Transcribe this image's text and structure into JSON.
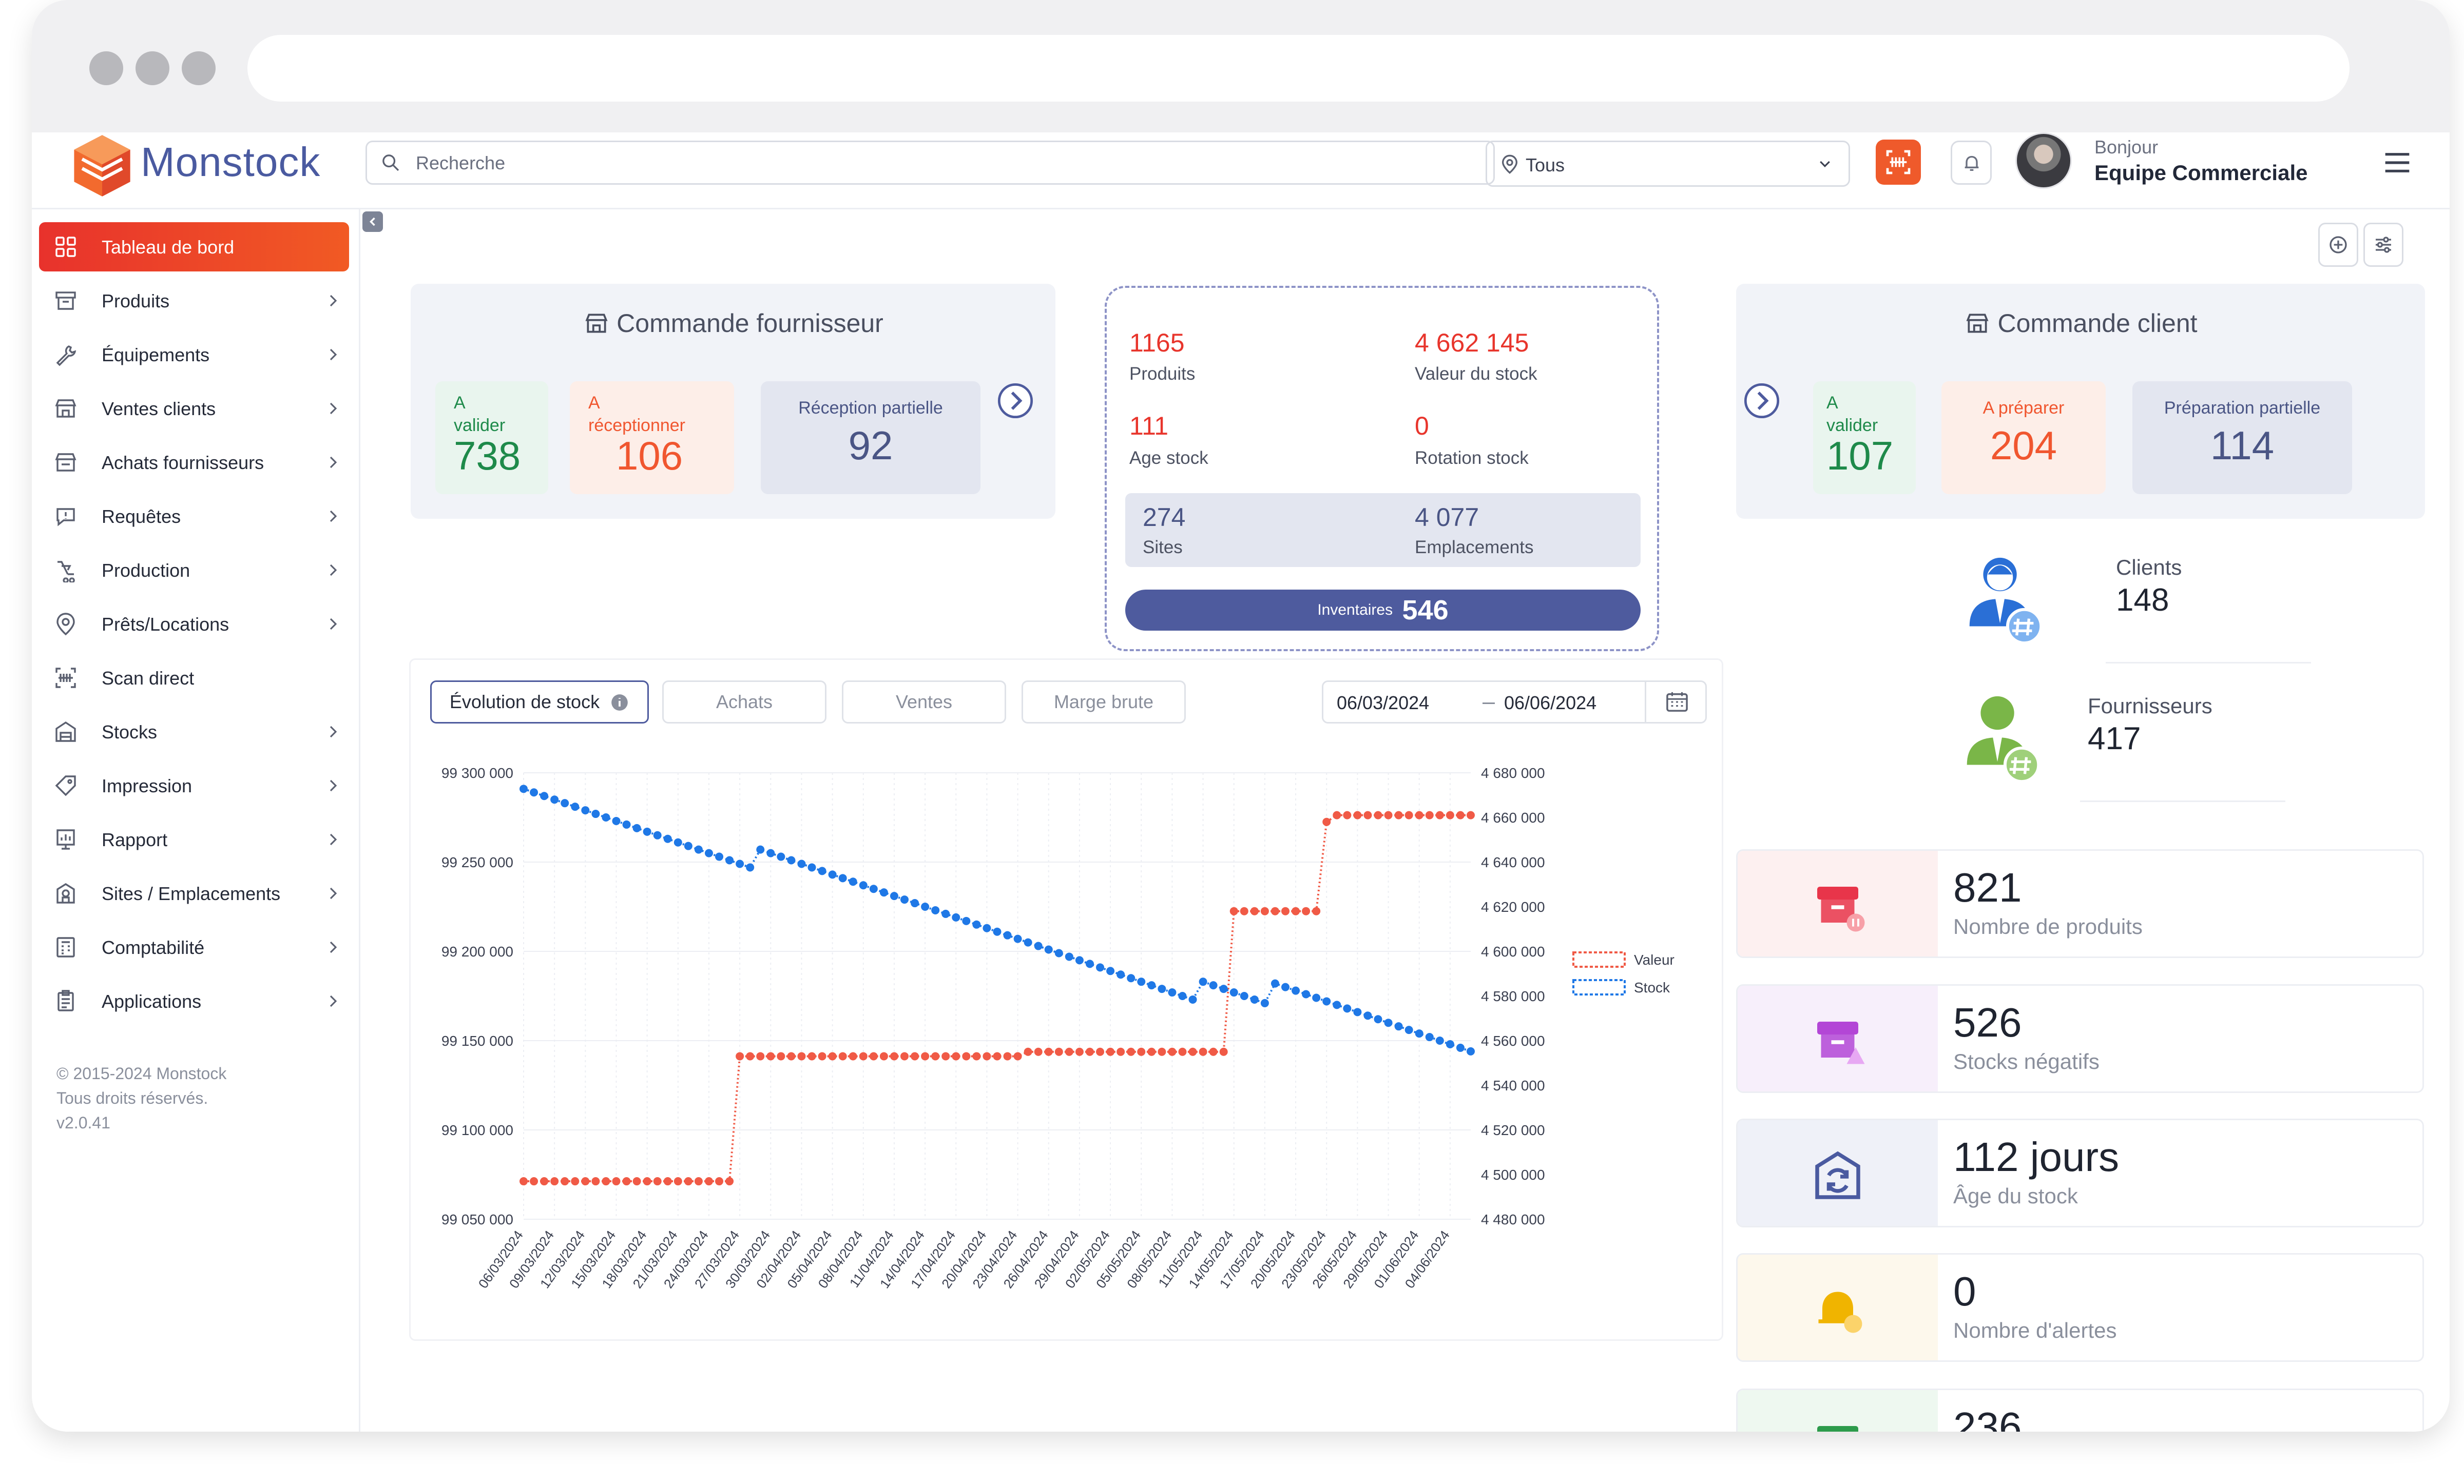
{
  "app": {
    "name": "Monstock"
  },
  "header": {
    "search_placeholder": "Recherche",
    "site_filter": "Tous",
    "greeting": "Bonjour",
    "user_name": "Equipe Commerciale"
  },
  "sidebar": {
    "items": [
      {
        "label": "Tableau de bord",
        "icon": "dashboard-icon",
        "active": true
      },
      {
        "label": "Produits",
        "icon": "box-icon"
      },
      {
        "label": "Équipements",
        "icon": "wrench-icon"
      },
      {
        "label": "Ventes clients",
        "icon": "store-icon"
      },
      {
        "label": "Achats fournisseurs",
        "icon": "cart-icon"
      },
      {
        "label": "Requêtes",
        "icon": "message-icon"
      },
      {
        "label": "Production",
        "icon": "factory-icon"
      },
      {
        "label": "Prêts/Locations",
        "icon": "location-pin-icon"
      },
      {
        "label": "Scan direct",
        "icon": "barcode-icon"
      },
      {
        "label": "Stocks",
        "icon": "warehouse-icon"
      },
      {
        "label": "Impression",
        "icon": "tag-icon"
      },
      {
        "label": "Rapport",
        "icon": "report-icon"
      },
      {
        "label": "Sites / Emplacements",
        "icon": "building-icon"
      },
      {
        "label": "Comptabilité",
        "icon": "calculator-icon"
      },
      {
        "label": "Applications",
        "icon": "clipboard-icon"
      }
    ],
    "footer": [
      "© 2015-2024 Monstock",
      "Tous droits réservés.",
      "v2.0.41"
    ]
  },
  "supplier_orders": {
    "title": "Commande fournisseur",
    "kpis": [
      {
        "label_1": "A",
        "label_2": "valider",
        "value": "738",
        "color": "#1e8a4a",
        "bg": "#e9f5ee"
      },
      {
        "label_1": "A",
        "label_2": "réceptionner",
        "value": "106",
        "color": "#f0562f",
        "bg": "#fdeee8"
      },
      {
        "label_1": "Réception partielle",
        "label_2": "",
        "value": "92",
        "color": "#4a5585",
        "bg": "#e3e6f0"
      }
    ]
  },
  "client_orders": {
    "title": "Commande client",
    "kpis": [
      {
        "label_1": "A",
        "label_2": "valider",
        "value": "107",
        "color": "#1e8a4a",
        "bg": "#e9f5ee"
      },
      {
        "label_1": "A préparer",
        "label_2": "",
        "value": "204",
        "color": "#f0562f",
        "bg": "#fdeee8"
      },
      {
        "label_1": "Préparation partielle",
        "label_2": "",
        "value": "114",
        "color": "#4a5585",
        "bg": "#e3e6f0"
      }
    ]
  },
  "inventory": {
    "products_value": "1165",
    "products_label": "Produits",
    "stock_value": "4 662 145",
    "stock_label": "Valeur du stock",
    "age_value": "111",
    "age_label": "Age stock",
    "rotation_value": "0",
    "rotation_label": "Rotation stock",
    "sites_value": "274",
    "sites_label": "Sites",
    "locations_value": "4 077",
    "locations_label": "Emplacements",
    "inventories_label": "Inventaires",
    "inventories_value": "546"
  },
  "contacts": {
    "clients_label": "Clients",
    "clients_value": "148",
    "suppliers_label": "Fournisseurs",
    "suppliers_value": "417"
  },
  "stats": [
    {
      "value": "821",
      "label": "Nombre de produits",
      "icon": "box-alert-icon",
      "bg": "#fdf0f0",
      "color": "#e8354a"
    },
    {
      "value": "526",
      "label": "Stocks négatifs",
      "icon": "box-warning-icon",
      "bg": "#f7effb",
      "color": "#b346d6"
    },
    {
      "value": "112 jours",
      "label": "Âge du stock",
      "icon": "warehouse-cycle-icon",
      "bg": "#eff1f8",
      "color": "#4a5aa0"
    },
    {
      "value": "0",
      "label": "Nombre d'alertes",
      "icon": "bell-alert-icon",
      "bg": "#fdf8ec",
      "color": "#f0b400"
    },
    {
      "value": "236",
      "label": "",
      "icon": "box-check-icon",
      "bg": "#eef8f0",
      "color": "#2c9b4b"
    }
  ],
  "chart_tabs": [
    "Évolution de stock",
    "Achats",
    "Ventes",
    "Marge brute"
  ],
  "date_from": "06/03/2024",
  "date_to": "06/06/2024",
  "chart_data": {
    "type": "line",
    "x_dates": [
      "06/03/2024",
      "07/03/2024",
      "08/03/2024",
      "09/03/2024",
      "10/03/2024",
      "11/03/2024",
      "12/03/2024",
      "13/03/2024",
      "14/03/2024",
      "15/03/2024",
      "16/03/2024",
      "17/03/2024",
      "18/03/2024",
      "19/03/2024",
      "20/03/2024",
      "21/03/2024",
      "22/03/2024",
      "23/03/2024",
      "24/03/2024",
      "25/03/2024",
      "26/03/2024",
      "27/03/2024",
      "28/03/2024",
      "29/03/2024",
      "30/03/2024",
      "31/03/2024",
      "01/04/2024",
      "02/04/2024",
      "03/04/2024",
      "04/04/2024",
      "05/04/2024",
      "06/04/2024",
      "07/04/2024",
      "08/04/2024",
      "09/04/2024",
      "10/04/2024",
      "11/04/2024",
      "12/04/2024",
      "13/04/2024",
      "14/04/2024",
      "15/04/2024",
      "16/04/2024",
      "17/04/2024",
      "18/04/2024",
      "19/04/2024",
      "20/04/2024",
      "21/04/2024",
      "22/04/2024",
      "23/04/2024",
      "24/04/2024",
      "25/04/2024",
      "26/04/2024",
      "27/04/2024",
      "28/04/2024",
      "29/04/2024",
      "30/04/2024",
      "01/05/2024",
      "02/05/2024",
      "03/05/2024",
      "04/05/2024",
      "05/05/2024",
      "06/05/2024",
      "07/05/2024",
      "08/05/2024",
      "09/05/2024",
      "10/05/2024",
      "11/05/2024",
      "12/05/2024",
      "13/05/2024",
      "14/05/2024",
      "15/05/2024",
      "16/05/2024",
      "17/05/2024",
      "18/05/2024",
      "19/05/2024",
      "20/05/2024",
      "21/05/2024",
      "22/05/2024",
      "23/05/2024",
      "24/05/2024",
      "25/05/2024",
      "26/05/2024",
      "27/05/2024",
      "28/05/2024",
      "29/05/2024",
      "30/05/2024",
      "31/05/2024",
      "01/06/2024",
      "02/06/2024",
      "03/06/2024",
      "04/06/2024",
      "05/06/2024",
      "06/06/2024"
    ],
    "x_tick_labels": [
      "06/03/2024",
      "09/03/2024",
      "12/03/2024",
      "15/03/2024",
      "18/03/2024",
      "21/03/2024",
      "24/03/2024",
      "27/03/2024",
      "30/03/2024",
      "02/04/2024",
      "05/04/2024",
      "08/04/2024",
      "11/04/2024",
      "14/04/2024",
      "17/04/2024",
      "20/04/2024",
      "23/04/2024",
      "26/04/2024",
      "29/04/2024",
      "02/05/2024",
      "05/05/2024",
      "08/05/2024",
      "11/05/2024",
      "14/05/2024",
      "17/05/2024",
      "20/05/2024",
      "23/05/2024",
      "26/05/2024",
      "29/05/2024",
      "01/06/2024",
      "04/06/2024"
    ],
    "y_left_ticks": [
      "99 300 000",
      "99 250 000",
      "99 200 000",
      "99 150 000",
      "99 100 000",
      "99 050 000"
    ],
    "y_left_lim": [
      99050000,
      99300000
    ],
    "y_right_ticks": [
      "4 680 000",
      "4 660 000",
      "4 640 000",
      "4 620 000",
      "4 600 000",
      "4 580 000",
      "4 560 000",
      "4 540 000",
      "4 520 000",
      "4 500 000",
      "4 480 000"
    ],
    "y_right_lim": [
      4480000,
      4680000
    ],
    "grid": true,
    "legend_position": "right",
    "series": [
      {
        "name": "Valeur",
        "axis": "right",
        "color": "#f05a46",
        "values": [
          4497000,
          4497000,
          4497000,
          4497000,
          4497000,
          4497000,
          4497000,
          4497000,
          4497000,
          4497000,
          4497000,
          4497000,
          4497000,
          4497000,
          4497000,
          4497000,
          4497000,
          4497000,
          4497000,
          4497000,
          4497000,
          4553000,
          4553000,
          4553000,
          4553000,
          4553000,
          4553000,
          4553000,
          4553000,
          4553000,
          4553000,
          4553000,
          4553000,
          4553000,
          4553000,
          4553000,
          4553000,
          4553000,
          4553000,
          4553000,
          4553000,
          4553000,
          4553000,
          4553000,
          4553000,
          4553000,
          4553000,
          4553000,
          4553000,
          4555000,
          4555000,
          4555000,
          4555000,
          4555000,
          4555000,
          4555000,
          4555000,
          4555000,
          4555000,
          4555000,
          4555000,
          4555000,
          4555000,
          4555000,
          4555000,
          4555000,
          4555000,
          4555000,
          4555000,
          4618000,
          4618000,
          4618000,
          4618000,
          4618000,
          4618000,
          4618000,
          4618000,
          4618000,
          4658000,
          4661000,
          4661000,
          4661000,
          4661000,
          4661000,
          4661000,
          4661000,
          4661000,
          4661000,
          4661000,
          4661000,
          4661000,
          4661000,
          4661000
        ]
      },
      {
        "name": "Stock",
        "axis": "left",
        "color": "#1f78e6",
        "values": [
          99291000,
          99289000,
          99287000,
          99285000,
          99283000,
          99281000,
          99279000,
          99277000,
          99275000,
          99273000,
          99271000,
          99269000,
          99267000,
          99265000,
          99263000,
          99261000,
          99259000,
          99257000,
          99255000,
          99253000,
          99251000,
          99249000,
          99247000,
          99257000,
          99255000,
          99253000,
          99251000,
          99249000,
          99247000,
          99245000,
          99243000,
          99241000,
          99239000,
          99237000,
          99235000,
          99233000,
          99231000,
          99229000,
          99227000,
          99225000,
          99223000,
          99221000,
          99219000,
          99217000,
          99215000,
          99213000,
          99211000,
          99209000,
          99207000,
          99205000,
          99203000,
          99201000,
          99199000,
          99197000,
          99195000,
          99193000,
          99191000,
          99189000,
          99187000,
          99185000,
          99183000,
          99181000,
          99179000,
          99177000,
          99175000,
          99173000,
          99183000,
          99181000,
          99179000,
          99177000,
          99175000,
          99173000,
          99171000,
          99182000,
          99180000,
          99178000,
          99176000,
          99174000,
          99172000,
          99170000,
          99168000,
          99166000,
          99164000,
          99162000,
          99160000,
          99158000,
          99156000,
          99154000,
          99152000,
          99150000,
          99148000,
          99146000,
          99144000
        ]
      }
    ]
  }
}
